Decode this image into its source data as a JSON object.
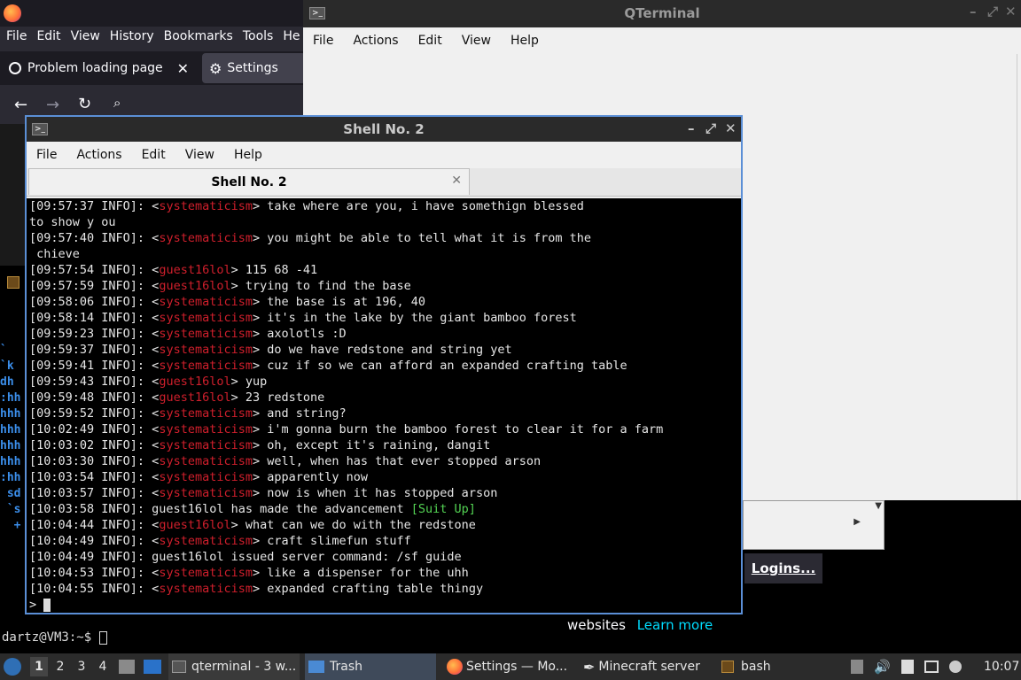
{
  "firefox": {
    "menu": [
      "File",
      "Edit",
      "View",
      "History",
      "Bookmarks",
      "Tools",
      "He"
    ],
    "tab1": "Problem loading page",
    "tab2": "Settings",
    "content_text": "websites",
    "learn_more": "Learn more",
    "logins_button": "Logins..."
  },
  "qterminal": {
    "title": "QTerminal",
    "menu": [
      "File",
      "Actions",
      "Edit",
      "View",
      "Help"
    ]
  },
  "shell": {
    "title": "Shell No. 2",
    "menu": [
      "File",
      "Actions",
      "Edit",
      "View",
      "Help"
    ],
    "tab_label": "Shell No. 2",
    "lines": [
      {
        "prefix": "[09:57:37 INFO]: <",
        "nick": "systematicism",
        "rest": "> take where are you, i have somethign blessed"
      },
      {
        "prefix": "to show y ou",
        "nick": "",
        "rest": ""
      },
      {
        "prefix": "[09:57:40 INFO]: <",
        "nick": "systematicism",
        "rest": "> you might be able to tell what it is from the"
      },
      {
        "prefix": " chieve",
        "nick": "",
        "rest": ""
      },
      {
        "prefix": "[09:57:54 INFO]: <",
        "nick": "guest16lol",
        "rest": "> 115 68 -41"
      },
      {
        "prefix": "[09:57:59 INFO]: <",
        "nick": "guest16lol",
        "rest": "> trying to find the base"
      },
      {
        "prefix": "[09:58:06 INFO]: <",
        "nick": "systematicism",
        "rest": "> the base is at 196, 40"
      },
      {
        "prefix": "[09:58:14 INFO]: <",
        "nick": "systematicism",
        "rest": "> it's in the lake by the giant bamboo forest"
      },
      {
        "prefix": "[09:59:23 INFO]: <",
        "nick": "systematicism",
        "rest": "> axolotls :D"
      },
      {
        "prefix": "[09:59:37 INFO]: <",
        "nick": "systematicism",
        "rest": "> do we have redstone and string yet"
      },
      {
        "prefix": "[09:59:41 INFO]: <",
        "nick": "systematicism",
        "rest": "> cuz if so we can afford an expanded crafting table"
      },
      {
        "prefix": "[09:59:43 INFO]: <",
        "nick": "guest16lol",
        "rest": "> yup"
      },
      {
        "prefix": "[09:59:48 INFO]: <",
        "nick": "guest16lol",
        "rest": "> 23 redstone"
      },
      {
        "prefix": "[09:59:52 INFO]: <",
        "nick": "systematicism",
        "rest": "> and string?"
      },
      {
        "prefix": "[10:02:49 INFO]: <",
        "nick": "systematicism",
        "rest": "> i'm gonna burn the bamboo forest to clear it for a farm"
      },
      {
        "prefix": "[10:03:02 INFO]: <",
        "nick": "systematicism",
        "rest": "> oh, except it's raining, dangit"
      },
      {
        "prefix": "[10:03:30 INFO]: <",
        "nick": "systematicism",
        "rest": "> well, when has that ever stopped arson"
      },
      {
        "prefix": "[10:03:54 INFO]: <",
        "nick": "systematicism",
        "rest": "> apparently now"
      },
      {
        "prefix": "[10:03:57 INFO]: <",
        "nick": "systematicism",
        "rest": "> now is when it has stopped arson"
      },
      {
        "prefix": "[10:03:58 INFO]: guest16lol has made the advancement ",
        "nick": "",
        "rest": "",
        "adv": "[Suit Up]"
      },
      {
        "prefix": "[10:04:44 INFO]: <",
        "nick": "guest16lol",
        "rest": "> what can we do with the redstone"
      },
      {
        "prefix": "[10:04:49 INFO]: <",
        "nick": "systematicism",
        "rest": "> craft slimefun stuff"
      },
      {
        "prefix": "[10:04:49 INFO]: guest16lol issued server command: /sf guide",
        "nick": "",
        "rest": ""
      },
      {
        "prefix": "[10:04:53 INFO]: <",
        "nick": "systematicism",
        "rest": "> like a dispenser for the uhh"
      },
      {
        "prefix": "[10:04:55 INFO]: <",
        "nick": "systematicism",
        "rest": "> expanded crafting table thingy"
      }
    ],
    "input_prompt": ">"
  },
  "left_terminal": {
    "side_fragments": [
      "`",
      "`k",
      "dh",
      ":hh",
      "hhh",
      "hhh",
      "hhh",
      "hhh",
      ":hh",
      " sd",
      " `s",
      "  +"
    ],
    "prompt": "dartz@VM3:~$ "
  },
  "taskbar": {
    "workspaces": [
      "1",
      "2",
      "3",
      "4"
    ],
    "tasks": [
      {
        "label": "qterminal - 3 w...",
        "icon": "terminal-icon"
      },
      {
        "label": "Trash",
        "icon": "folder-icon"
      },
      {
        "label": "Settings — Mo...",
        "icon": "firefox-icon"
      },
      {
        "label": "Minecraft server",
        "icon": "feather-icon"
      },
      {
        "label": "bash",
        "icon": "terminal-icon"
      }
    ],
    "clock": "10:07"
  }
}
